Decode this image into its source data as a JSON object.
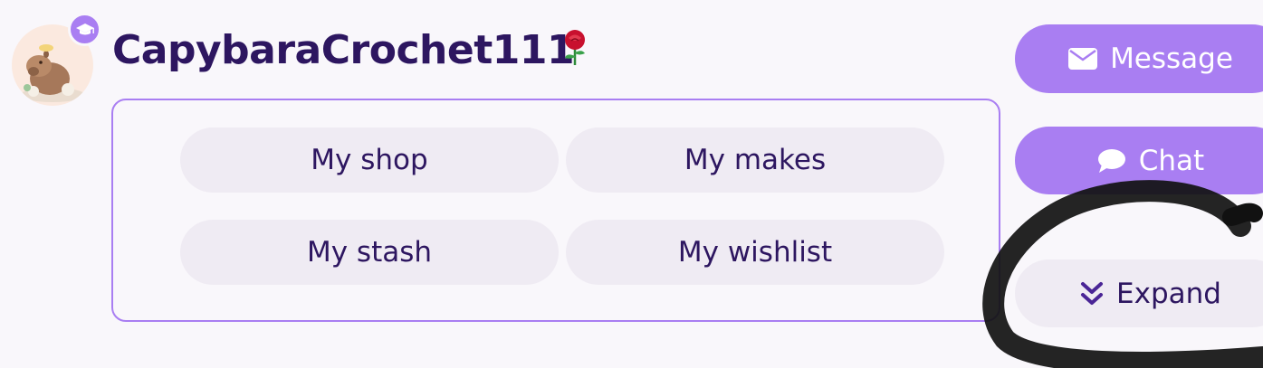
{
  "profile": {
    "username": "CapybaraCrochet111",
    "rose_emoji": "🌹",
    "avatar_icon": "capybara-avatar-icon",
    "badge_icon": "graduation-cap-icon"
  },
  "links": [
    {
      "label": "My shop"
    },
    {
      "label": "My makes"
    },
    {
      "label": "My stash"
    },
    {
      "label": "My wishlist"
    }
  ],
  "actions": {
    "message": {
      "label": "Message",
      "icon": "envelope-icon"
    },
    "chat": {
      "label": "Chat",
      "icon": "speech-bubble-icon"
    },
    "expand": {
      "label": "Expand",
      "icon": "double-chevron-down-icon"
    }
  },
  "colors": {
    "accent": "#a97ef2",
    "text": "#2d1660",
    "pill_bg": "#efebf3",
    "page_bg": "#f9f7fb"
  }
}
